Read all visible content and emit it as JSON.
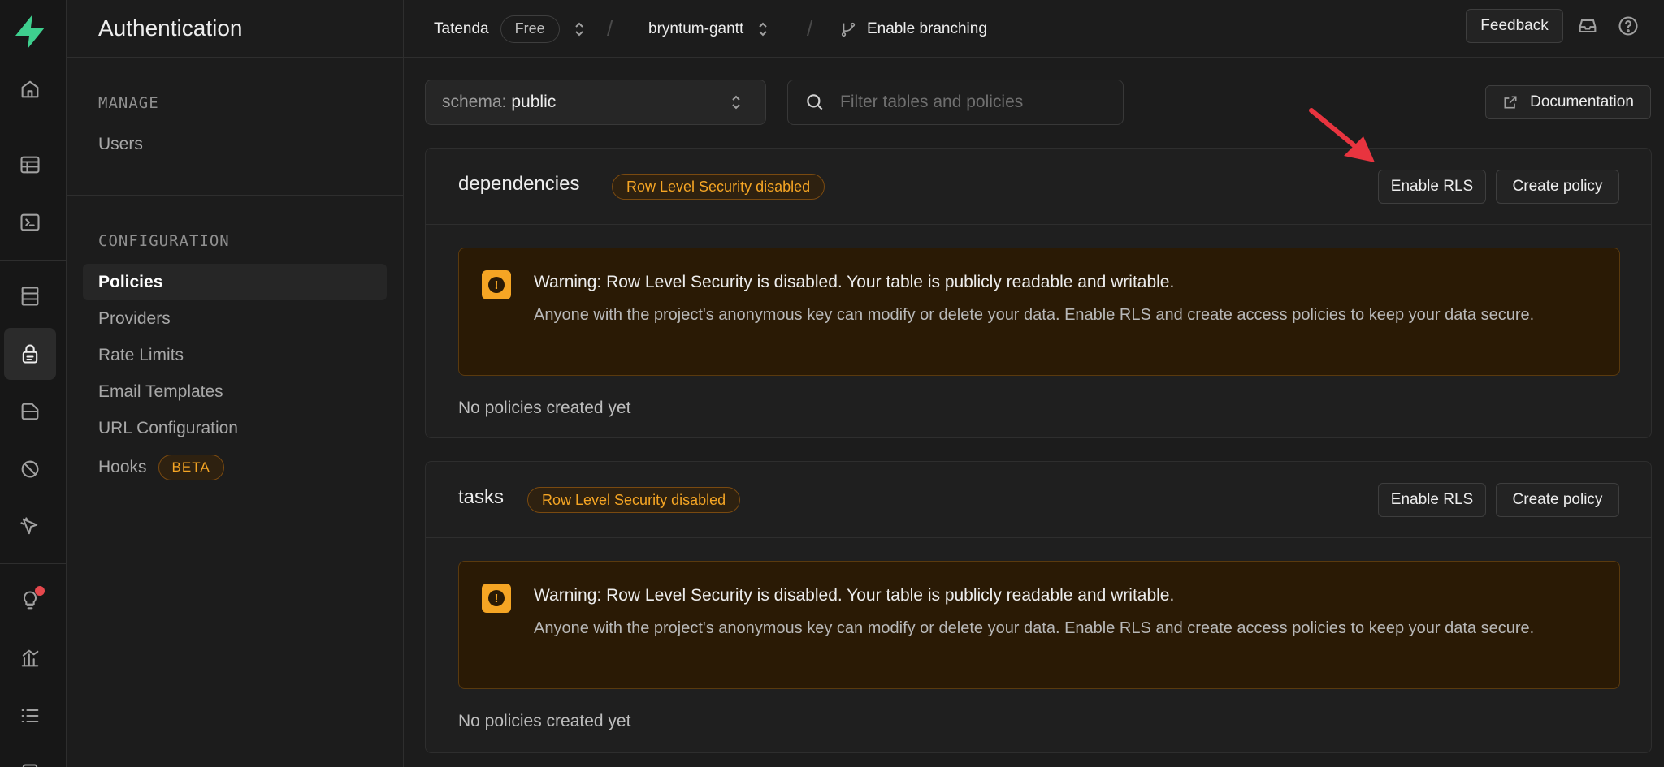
{
  "section_title": "Authentication",
  "nav": {
    "manage_label": "MANAGE",
    "manage_items": [
      {
        "label": "Users"
      }
    ],
    "config_label": "CONFIGURATION",
    "config_items": [
      {
        "label": "Policies",
        "active": true
      },
      {
        "label": "Providers"
      },
      {
        "label": "Rate Limits"
      },
      {
        "label": "Email Templates"
      },
      {
        "label": "URL Configuration"
      },
      {
        "label": "Hooks",
        "badge": "BETA"
      }
    ]
  },
  "topbar": {
    "org": "Tatenda",
    "plan": "Free",
    "project": "bryntum-gantt",
    "branch": "Enable branching",
    "feedback": "Feedback"
  },
  "toolbar": {
    "schema_key": "schema:",
    "schema_value": "public",
    "search_placeholder": "Filter tables and policies",
    "docs_label": "Documentation"
  },
  "tables": [
    {
      "name": "dependencies",
      "badge": "Row Level Security disabled",
      "enable_rls": "Enable RLS",
      "create_policy": "Create policy",
      "warning_title": "Warning: Row Level Security is disabled. Your table is publicly readable and writable.",
      "warning_desc": "Anyone with the project's anonymous key can modify or delete your data. Enable RLS and create access policies to keep your data secure.",
      "empty": "No policies created yet"
    },
    {
      "name": "tasks",
      "badge": "Row Level Security disabled",
      "enable_rls": "Enable RLS",
      "create_policy": "Create policy",
      "warning_title": "Warning: Row Level Security is disabled. Your table is publicly readable and writable.",
      "warning_desc": "Anyone with the project's anonymous key can modify or delete your data. Enable RLS and create access policies to keep your data secure.",
      "empty": "No policies created yet"
    }
  ],
  "colors": {
    "brand": "#3ecf8e",
    "warning": "#f5a524",
    "annotation_arrow": "#e8343f"
  }
}
